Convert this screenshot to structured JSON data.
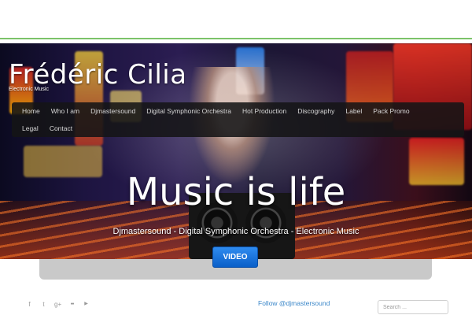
{
  "site": {
    "title": "Frédéric Cilia",
    "tagline": "Electronic Music"
  },
  "nav": {
    "row1": [
      "Home",
      "Who I am",
      "Djmastersound",
      "Digital Symphonic Orchestra",
      "Hot Production",
      "Discography",
      "Label",
      "Pack Promo"
    ],
    "row2": [
      "Legal",
      "Contact"
    ]
  },
  "hero": {
    "headline": "Music is life",
    "subtitle": "Djmastersound - Digital Symphonic Orchestra - Electronic Music",
    "button_label": "VIDEO"
  },
  "footer": {
    "social_icons": [
      "facebook-icon",
      "twitter-icon",
      "google-plus-icon",
      "flickr-icon",
      "youtube-icon"
    ],
    "social_glyphs": [
      "f",
      "t",
      "g+",
      "●●",
      "▶"
    ],
    "follow_text": "Follow @djmastersound",
    "search_placeholder": "Search ..."
  },
  "colors": {
    "accent_line": "#7cc36a",
    "button": "#1a73dc",
    "link": "#3b87c9"
  }
}
